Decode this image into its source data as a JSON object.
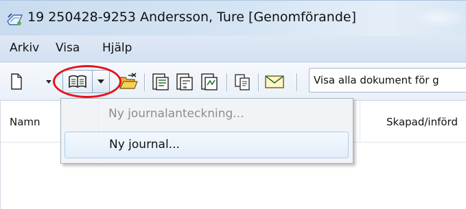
{
  "window": {
    "title": "19 250428-9253 Andersson, Ture [Genomförande]"
  },
  "menubar": {
    "items": [
      "Arkiv",
      "Visa",
      "Hjälp"
    ]
  },
  "toolbar": {
    "document_filter": "Visa alla dokument för g"
  },
  "list": {
    "columns": [
      "Namn",
      "Skapad/införd"
    ]
  },
  "dropdown": {
    "items": [
      {
        "label": "Ny journalanteckning...",
        "enabled": false
      },
      {
        "label": "Ny journal...",
        "enabled": true,
        "highlighted": true
      }
    ]
  },
  "colors": {
    "highlight_circle": "#e8111a",
    "titlebar": "#c9dcef",
    "menu_bg": "#f1f4f7",
    "hover_border": "#a8cdee"
  }
}
